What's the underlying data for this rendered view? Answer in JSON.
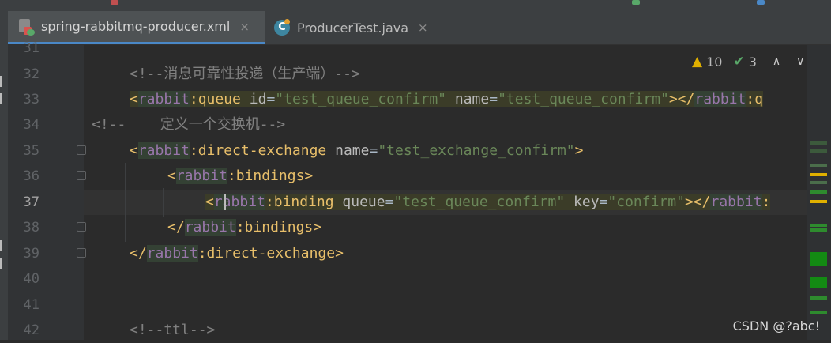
{
  "tabs": [
    {
      "label": "spring-rabbitmq-producer.xml",
      "icon": "xml-file-icon",
      "active": true,
      "close": "×"
    },
    {
      "label": "ProducerTest.java",
      "icon": "java-class-icon",
      "active": false,
      "close": "×"
    }
  ],
  "inspection": {
    "warnings": "10",
    "weak_warnings": "3",
    "warn_glyph": "▲",
    "ok_glyph": "✔",
    "up_glyph": "∧",
    "down_glyph": "∨"
  },
  "editor": {
    "current_line": 37,
    "lines": [
      {
        "num": "31",
        "text": ""
      },
      {
        "num": "32",
        "text": "<!--消息可靠性投递（生产端）-->"
      },
      {
        "num": "33",
        "text": "<rabbit:queue id=\"test_queue_confirm\" name=\"test_queue_confirm\"></rabbit:q"
      },
      {
        "num": "34",
        "text": "<!--    定义一个交换机-->"
      },
      {
        "num": "35",
        "text": "<rabbit:direct-exchange name=\"test_exchange_confirm\">"
      },
      {
        "num": "36",
        "text": "<rabbit:bindings>"
      },
      {
        "num": "37",
        "text": "<rabbit:binding queue=\"test_queue_confirm\" key=\"confirm\"></rabbit:"
      },
      {
        "num": "38",
        "text": "</rabbit:bindings>"
      },
      {
        "num": "39",
        "text": "</rabbit:direct-exchange>"
      },
      {
        "num": "40",
        "text": ""
      },
      {
        "num": "41",
        "text": ""
      },
      {
        "num": "42",
        "text": "<!--ttl-->"
      }
    ]
  },
  "watermark": "CSDN @?abc!",
  "colors": {
    "tag": "#e8bf6a",
    "namespace": "#9876aa",
    "attribute": "#bababa",
    "value": "#6a8759",
    "comment": "#808080",
    "background": "#2b2b2b"
  }
}
